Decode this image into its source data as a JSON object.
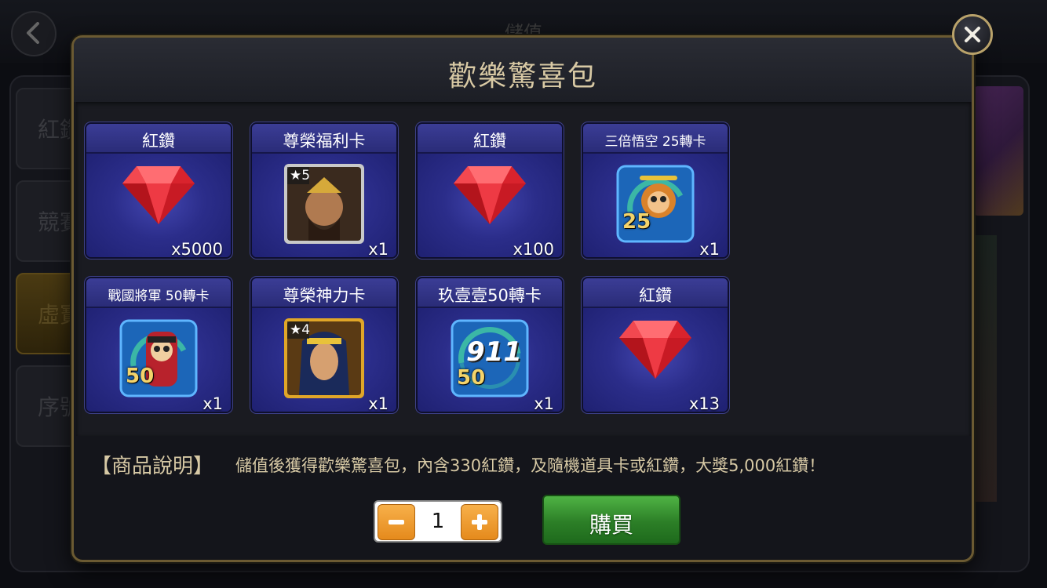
{
  "background": {
    "title": "儲值",
    "tabs": [
      "紅鑽",
      "競賽",
      "虛寶",
      "序號"
    ]
  },
  "modal": {
    "title": "歡樂驚喜包",
    "items": [
      {
        "name": "紅鑽",
        "qty": "x5000",
        "icon": "gem-icon"
      },
      {
        "name": "尊榮福利卡",
        "qty": "x1",
        "icon": "warlord-card-icon",
        "stars": "★5"
      },
      {
        "name": "紅鑽",
        "qty": "x100",
        "icon": "gem-icon"
      },
      {
        "name": "三倍悟空 25轉卡",
        "qty": "x1",
        "icon": "monkey-spin-card-icon",
        "spins": "25"
      },
      {
        "name": "戰國將軍 50轉卡",
        "qty": "x1",
        "icon": "general-spin-card-icon",
        "spins": "50"
      },
      {
        "name": "尊榮神力卡",
        "qty": "x1",
        "icon": "cleopatra-card-icon",
        "stars": "★4"
      },
      {
        "name": "玖壹壹50轉卡",
        "qty": "x1",
        "icon": "911-spin-card-icon",
        "spins": "50",
        "badge": "911"
      },
      {
        "name": "紅鑽",
        "qty": "x13",
        "icon": "gem-icon"
      }
    ],
    "description_label": "【商品說明】",
    "description": "儲值後獲得歡樂驚喜包，內含330紅鑽，及隨機道具卡或紅鑽，大獎5,000紅鑽！",
    "quantity": "1",
    "buy_label": "購買"
  },
  "colors": {
    "accent_gold": "#d7c9a5",
    "card_blue": "#2b2d8a",
    "buy_green": "#2c7f27",
    "stepper_orange": "#e58a1c"
  }
}
